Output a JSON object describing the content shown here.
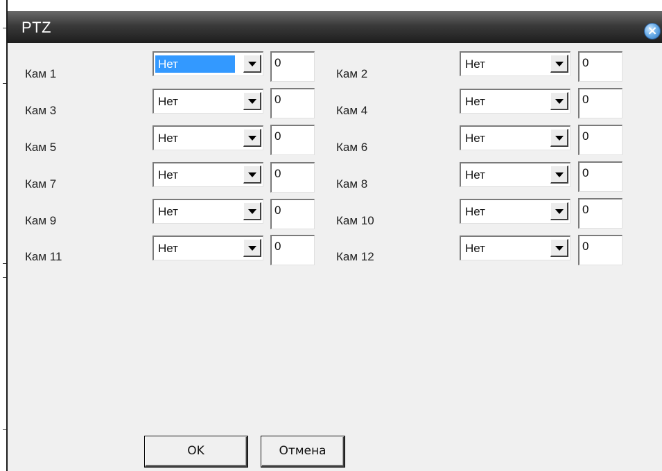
{
  "dialog": {
    "title": "PTZ",
    "close_icon": "close-icon"
  },
  "cameras": [
    {
      "label": "Кам 1",
      "protocol": "Нет",
      "address": "0"
    },
    {
      "label": "Кам 2",
      "protocol": "Нет",
      "address": "0"
    },
    {
      "label": "Кам 3",
      "protocol": "Нет",
      "address": "0"
    },
    {
      "label": "Кам 4",
      "protocol": "Нет",
      "address": "0"
    },
    {
      "label": "Кам 5",
      "protocol": "Нет",
      "address": "0"
    },
    {
      "label": "Кам 6",
      "protocol": "Нет",
      "address": "0"
    },
    {
      "label": "Кам 7",
      "protocol": "Нет",
      "address": "0"
    },
    {
      "label": "Кам 8",
      "protocol": "Нет",
      "address": "0"
    },
    {
      "label": "Кам 9",
      "protocol": "Нет",
      "address": "0"
    },
    {
      "label": "Кам 10",
      "protocol": "Нет",
      "address": "0"
    },
    {
      "label": "Кам 11",
      "protocol": "Нет",
      "address": "0"
    },
    {
      "label": "Кам 12",
      "protocol": "Нет",
      "address": "0"
    }
  ],
  "buttons": {
    "ok": "OK",
    "cancel": "Отмена"
  },
  "colors": {
    "selection": "#3399ff",
    "dialog_bg": "#f0f0f0",
    "titlebar": "#2a2a2a"
  }
}
